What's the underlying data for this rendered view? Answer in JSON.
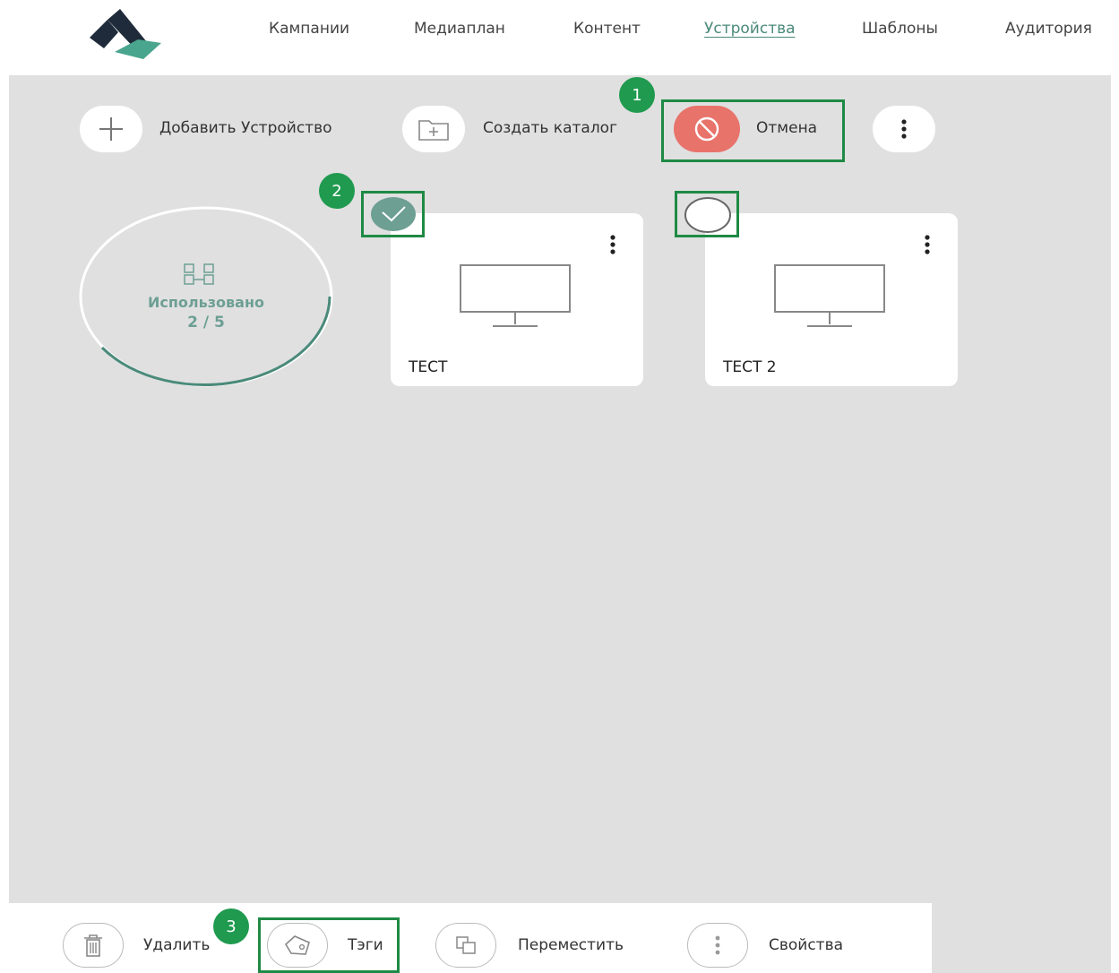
{
  "nav": {
    "items": [
      {
        "label": "Кампании"
      },
      {
        "label": "Медиаплан"
      },
      {
        "label": "Контент"
      },
      {
        "label": "Устройства"
      },
      {
        "label": "Шаблоны"
      },
      {
        "label": "Аудитория"
      }
    ],
    "active": "Устройства"
  },
  "toolbar": {
    "add_device_label": "Добавить Устройство",
    "create_folder_label": "Создать каталог",
    "cancel_label": "Отмена"
  },
  "usage": {
    "label": "Использовано",
    "value": "2 / 5"
  },
  "devices": [
    {
      "name": "ТЕСТ",
      "selected": true
    },
    {
      "name": "ТЕСТ 2",
      "selected": false
    }
  ],
  "actions": {
    "delete_label": "Удалить",
    "tags_label": "Тэги",
    "move_label": "Переместить",
    "properties_label": "Свойства"
  },
  "steps": [
    "1",
    "2",
    "3"
  ],
  "colors": {
    "accent": "#4a8a7a",
    "step_badge": "#1f9a4f",
    "highlight": "#1f8a45",
    "cancel": "#e8736b",
    "checkbox_checked": "#6d9f93",
    "background": "#e0e0e0"
  },
  "icons": [
    "logo",
    "plus-icon",
    "folder-plus-icon",
    "cancel-icon",
    "more-vertical-icon",
    "devices-icon",
    "monitor-icon",
    "check-icon",
    "trash-icon",
    "tag-icon",
    "move-icon",
    "properties-icon"
  ]
}
